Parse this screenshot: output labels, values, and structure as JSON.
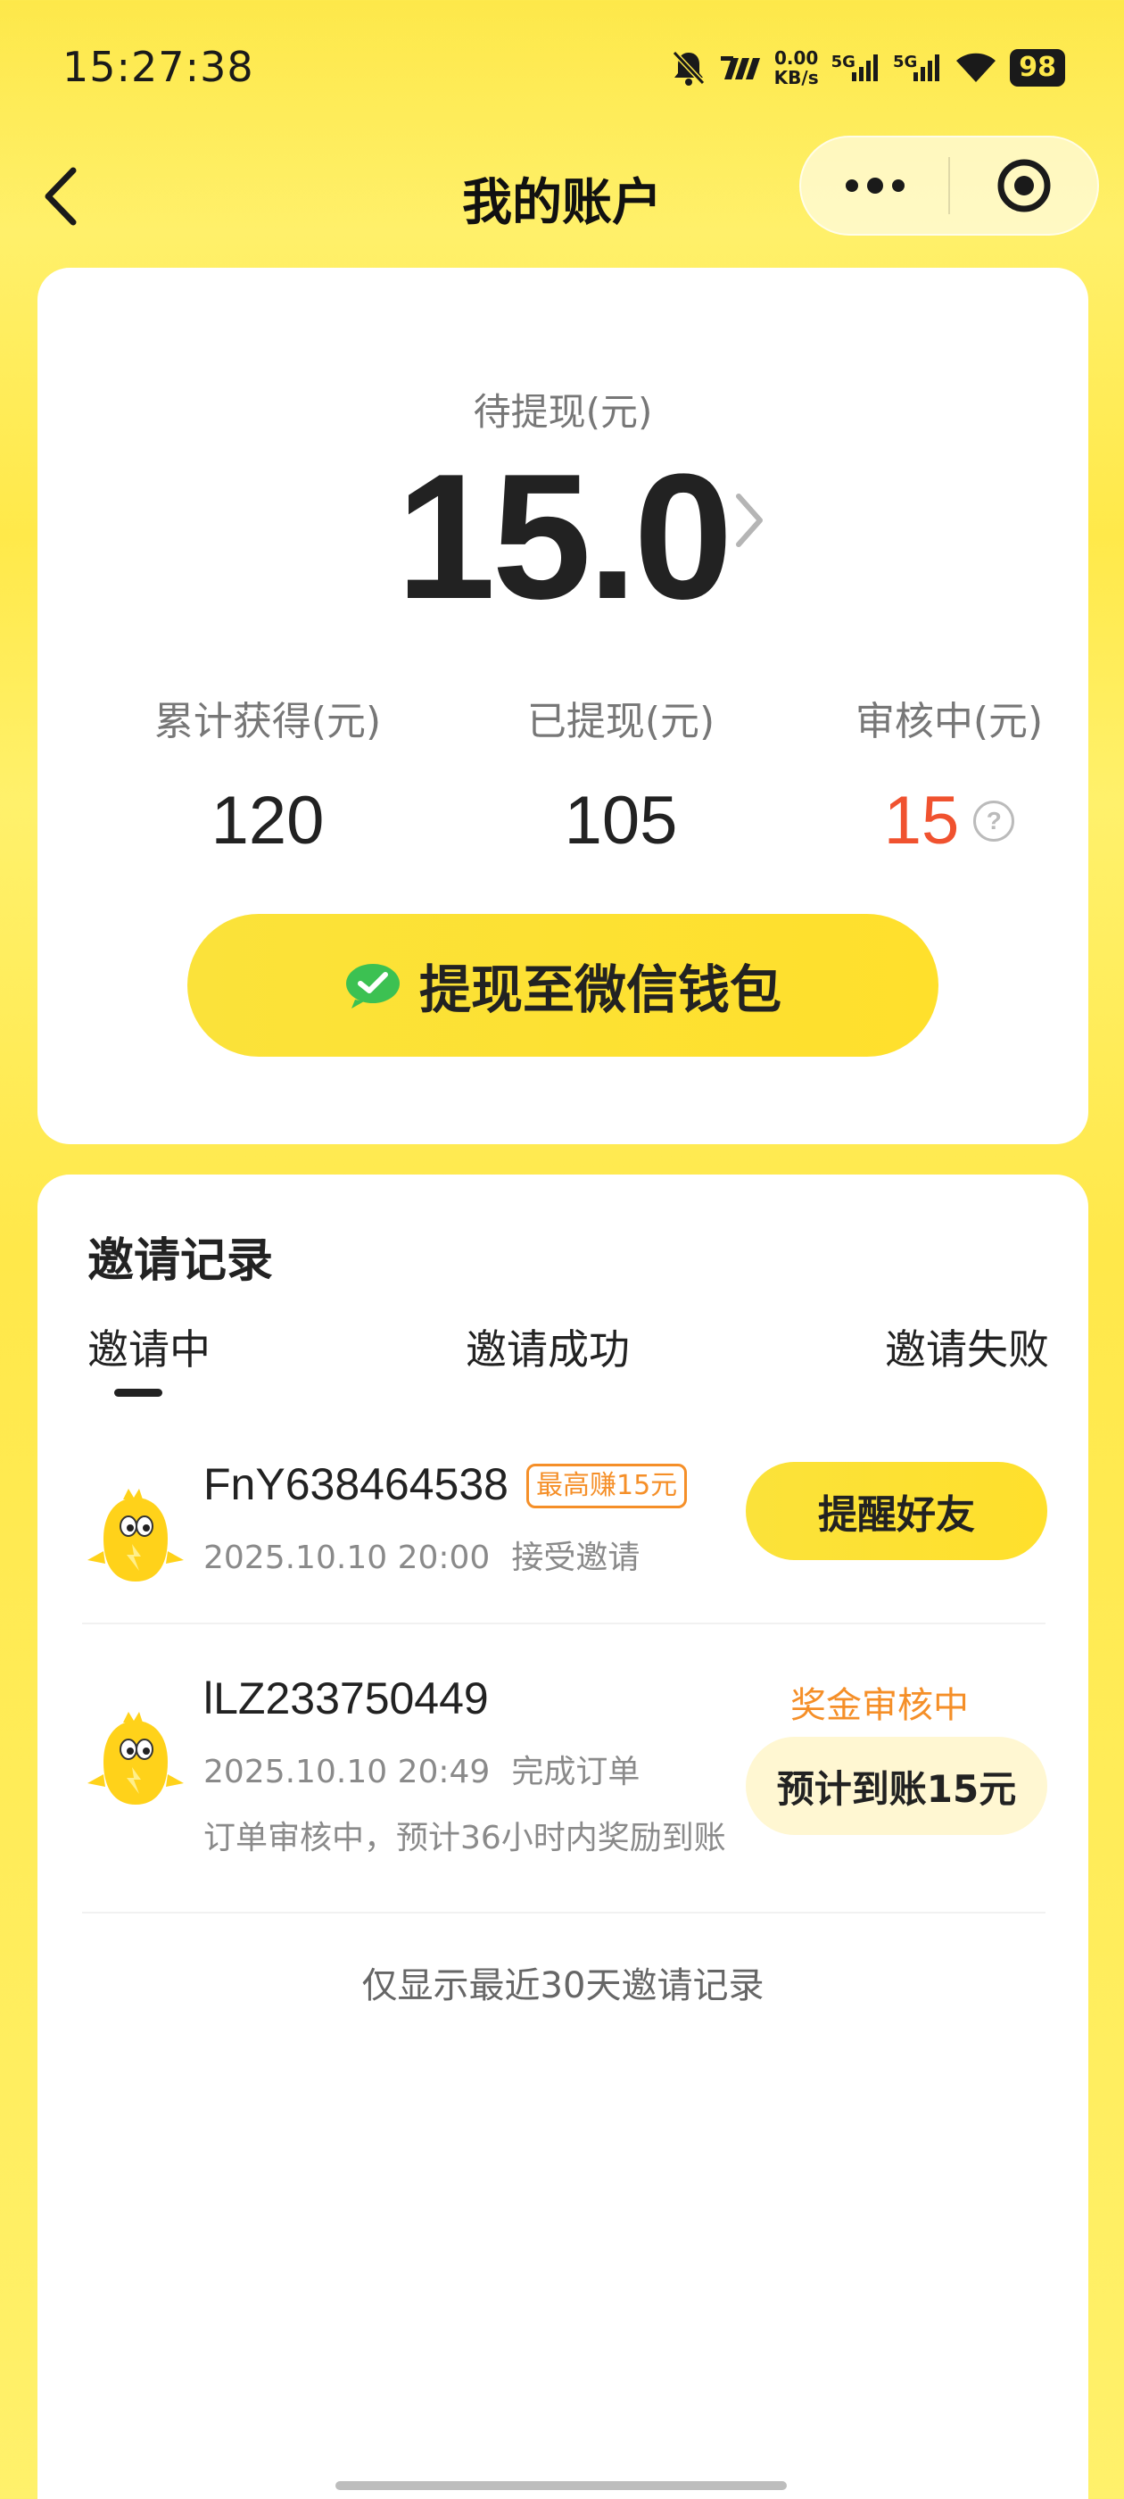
{
  "status_bar": {
    "time": "15:27:38",
    "net_speed_value": "0.00",
    "net_speed_unit": "KB/s",
    "signal_1_label": "5G",
    "signal_2_label": "5G",
    "battery": "98",
    "icons": [
      "mute-bell-icon",
      "carrier-logo-icon",
      "signal-icon",
      "signal-icon",
      "wifi-icon",
      "battery-icon"
    ]
  },
  "header": {
    "title": "我的账户"
  },
  "account": {
    "balance_label": "待提现(元)",
    "balance_value": "15.0",
    "stats": [
      {
        "label": "累计获得(元)",
        "value": "120"
      },
      {
        "label": "已提现(元)",
        "value": "105"
      },
      {
        "label": "审核中(元)",
        "value": "15"
      }
    ],
    "help_glyph": "?",
    "withdraw_button": "提现至微信钱包"
  },
  "invites": {
    "title": "邀请记录",
    "tabs": [
      "邀请中",
      "邀请成功",
      "邀请失败"
    ],
    "active_tab": 0,
    "records": [
      {
        "user_id": "FnY638464538",
        "tag": "最高赚15元",
        "datetime": "2025.10.10 20:00",
        "status": "接受邀请",
        "action": "提醒好友"
      },
      {
        "user_id": "lLZ233750449",
        "datetime": "2025.10.10 20:49",
        "status": "完成订单",
        "note": "订单审核中，预计36小时内奖励到账",
        "audit_label": "奖金审核中",
        "expected": "预计到账15元"
      }
    ],
    "footer_note": "仅显示最近30天邀请记录"
  },
  "colors": {
    "brand_yellow": "#fde84a",
    "accent_orange": "#f58f28",
    "pending_red": "#f0522f",
    "wechat_green": "#3cc152"
  }
}
